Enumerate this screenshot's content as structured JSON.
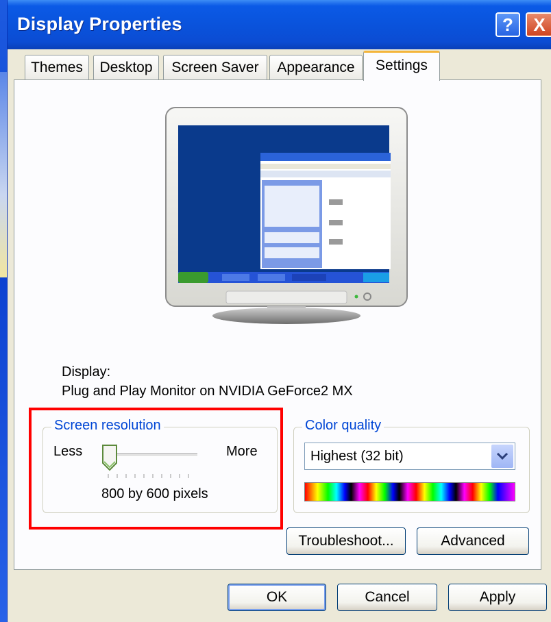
{
  "window": {
    "title": "Display Properties"
  },
  "titlebar": {
    "help_glyph": "?",
    "close_glyph": "X"
  },
  "tabs": [
    {
      "label": "Themes"
    },
    {
      "label": "Desktop"
    },
    {
      "label": "Screen Saver"
    },
    {
      "label": "Appearance"
    },
    {
      "label": "Settings",
      "selected": true
    }
  ],
  "display": {
    "label": "Display:",
    "device": "Plug and Play Monitor on NVIDIA GeForce2 MX"
  },
  "screen_resolution": {
    "legend": "Screen resolution",
    "less_label": "Less",
    "more_label": "More",
    "value_text": "800 by 600 pixels",
    "slider_level": 0
  },
  "color_quality": {
    "legend": "Color quality",
    "selected": "Highest (32 bit)"
  },
  "buttons": {
    "troubleshoot": "Troubleshoot...",
    "advanced": "Advanced",
    "ok": "OK",
    "cancel": "Cancel",
    "apply": "Apply"
  },
  "icons": {
    "help": "help-icon",
    "close": "close-icon",
    "monitor": "monitor-preview-icon",
    "dropdown": "chevron-down-icon"
  },
  "colors": {
    "titlebar": "#0a53dc",
    "accent_text": "#0046d5",
    "highlight": "#ff0000",
    "tab_active_top": "#f4b53b"
  }
}
